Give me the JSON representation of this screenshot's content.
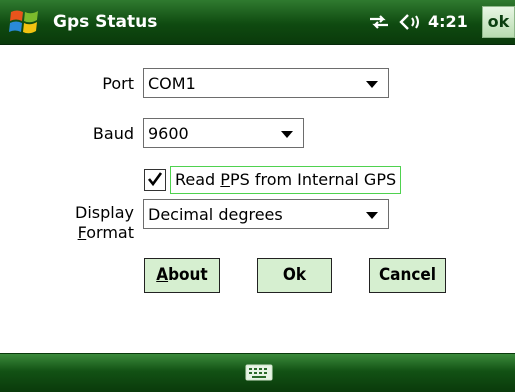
{
  "titlebar": {
    "title": "Gps Status",
    "time": "4:21",
    "ok_label": "ok",
    "icons": [
      "windows-logo-icon",
      "network-icon",
      "volume-icon"
    ]
  },
  "form": {
    "port": {
      "label": "Port",
      "value": "COM1"
    },
    "baud": {
      "label": "Baud",
      "value": "9600"
    },
    "pps": {
      "label_pre": "Read ",
      "label_mnemonic": "P",
      "label_post": "PS from Internal GPS",
      "checked": true
    },
    "display_format": {
      "label_line1": "Display",
      "label_mnemonic": "F",
      "label_line2_rest": "ormat",
      "value": "Decimal degrees"
    }
  },
  "buttons": {
    "about": {
      "mnemonic": "A",
      "rest": "bout"
    },
    "ok": {
      "label": "Ok"
    },
    "cancel": {
      "label": "Cancel"
    }
  },
  "bottombar": {
    "icon": "keyboard-icon"
  },
  "colors": {
    "bar_green": "#0f4a10",
    "button_fill": "#d6efd0",
    "focus_border": "#4fd24f"
  }
}
